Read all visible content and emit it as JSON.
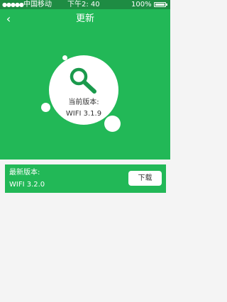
{
  "status_bar": {
    "signal": "●●●●●",
    "carrier": "中国移动",
    "time": "下午2: 40",
    "battery_text": "100%"
  },
  "header": {
    "back_icon": "‹",
    "title": "更新"
  },
  "hero": {
    "icon": "magnifier-icon",
    "current_version_label": "当前版本:",
    "current_version_value": "WIFI 3.1.9"
  },
  "latest": {
    "label": "最新版本:",
    "version": "WIFI 3.2.0",
    "download_label": "下载"
  },
  "colors": {
    "accent": "#22b857",
    "status_bar": "#1e8c43",
    "icon": "#1a9a4c",
    "background": "#f4f4f4"
  }
}
